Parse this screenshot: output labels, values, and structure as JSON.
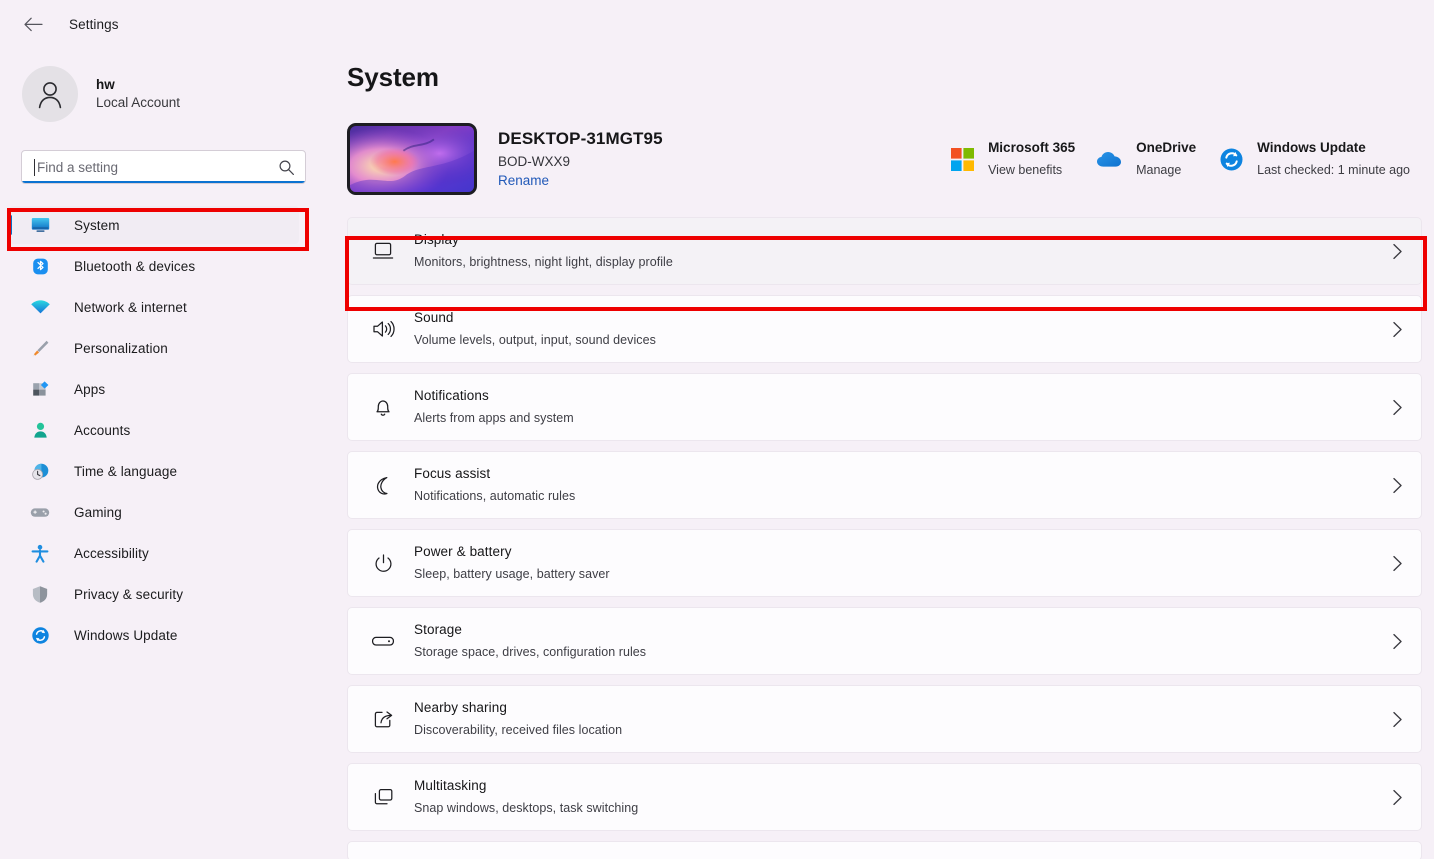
{
  "window": {
    "title": "Settings",
    "back_icon": "back-arrow-icon"
  },
  "colors": {
    "accent_blue": "#0c6ec4",
    "annotation_red": "#ee0000",
    "link_blue": "#2159b8",
    "page_background": "#f6f0f7",
    "card_background": "#fdfcfe"
  },
  "sidebar": {
    "profile": {
      "name": "hw",
      "account_type": "Local Account",
      "avatar_icon": "person-icon"
    },
    "search": {
      "placeholder": "Find a setting",
      "value": "",
      "icon": "search-icon"
    },
    "items": [
      {
        "label": "System",
        "icon": "monitor-icon",
        "selected": true
      },
      {
        "label": "Bluetooth & devices",
        "icon": "bluetooth-icon",
        "selected": false
      },
      {
        "label": "Network & internet",
        "icon": "wifi-icon",
        "selected": false
      },
      {
        "label": "Personalization",
        "icon": "paintbrush-icon",
        "selected": false
      },
      {
        "label": "Apps",
        "icon": "apps-icon",
        "selected": false
      },
      {
        "label": "Accounts",
        "icon": "account-person-icon",
        "selected": false
      },
      {
        "label": "Time & language",
        "icon": "clock-globe-icon",
        "selected": false
      },
      {
        "label": "Gaming",
        "icon": "gamepad-icon",
        "selected": false
      },
      {
        "label": "Accessibility",
        "icon": "accessibility-person-icon",
        "selected": false
      },
      {
        "label": "Privacy & security",
        "icon": "shield-icon",
        "selected": false
      },
      {
        "label": "Windows Update",
        "icon": "update-sync-icon",
        "selected": false
      }
    ]
  },
  "main": {
    "page_title": "System",
    "device": {
      "name": "DESKTOP-31MGT95",
      "model": "BOD-WXX9",
      "rename_label": "Rename",
      "thumbnail_icon": "desktop-wallpaper-thumbnail"
    },
    "quick_links": [
      {
        "title": "Microsoft 365",
        "subtitle": "View benefits",
        "icon": "microsoft-logo-icon"
      },
      {
        "title": "OneDrive",
        "subtitle": "Manage",
        "icon": "onedrive-cloud-icon"
      },
      {
        "title": "Windows Update",
        "subtitle": "Last checked: 1 minute ago",
        "icon": "update-sync-icon"
      }
    ],
    "settings_rows": [
      {
        "title": "Display",
        "subtitle": "Monitors, brightness, night light, display profile",
        "icon": "display-monitor-icon",
        "annotated": true
      },
      {
        "title": "Sound",
        "subtitle": "Volume levels, output, input, sound devices",
        "icon": "speaker-icon",
        "annotated": false
      },
      {
        "title": "Notifications",
        "subtitle": "Alerts from apps and system",
        "icon": "bell-icon",
        "annotated": false
      },
      {
        "title": "Focus assist",
        "subtitle": "Notifications, automatic rules",
        "icon": "moon-icon",
        "annotated": false
      },
      {
        "title": "Power & battery",
        "subtitle": "Sleep, battery usage, battery saver",
        "icon": "power-icon",
        "annotated": false
      },
      {
        "title": "Storage",
        "subtitle": "Storage space, drives, configuration rules",
        "icon": "drive-icon",
        "annotated": false
      },
      {
        "title": "Nearby sharing",
        "subtitle": "Discoverability, received files location",
        "icon": "share-icon",
        "annotated": false
      },
      {
        "title": "Multitasking",
        "subtitle": "Snap windows, desktops, task switching",
        "icon": "windows-stack-icon",
        "annotated": false
      }
    ],
    "chevron_icon": "chevron-right-icon"
  }
}
